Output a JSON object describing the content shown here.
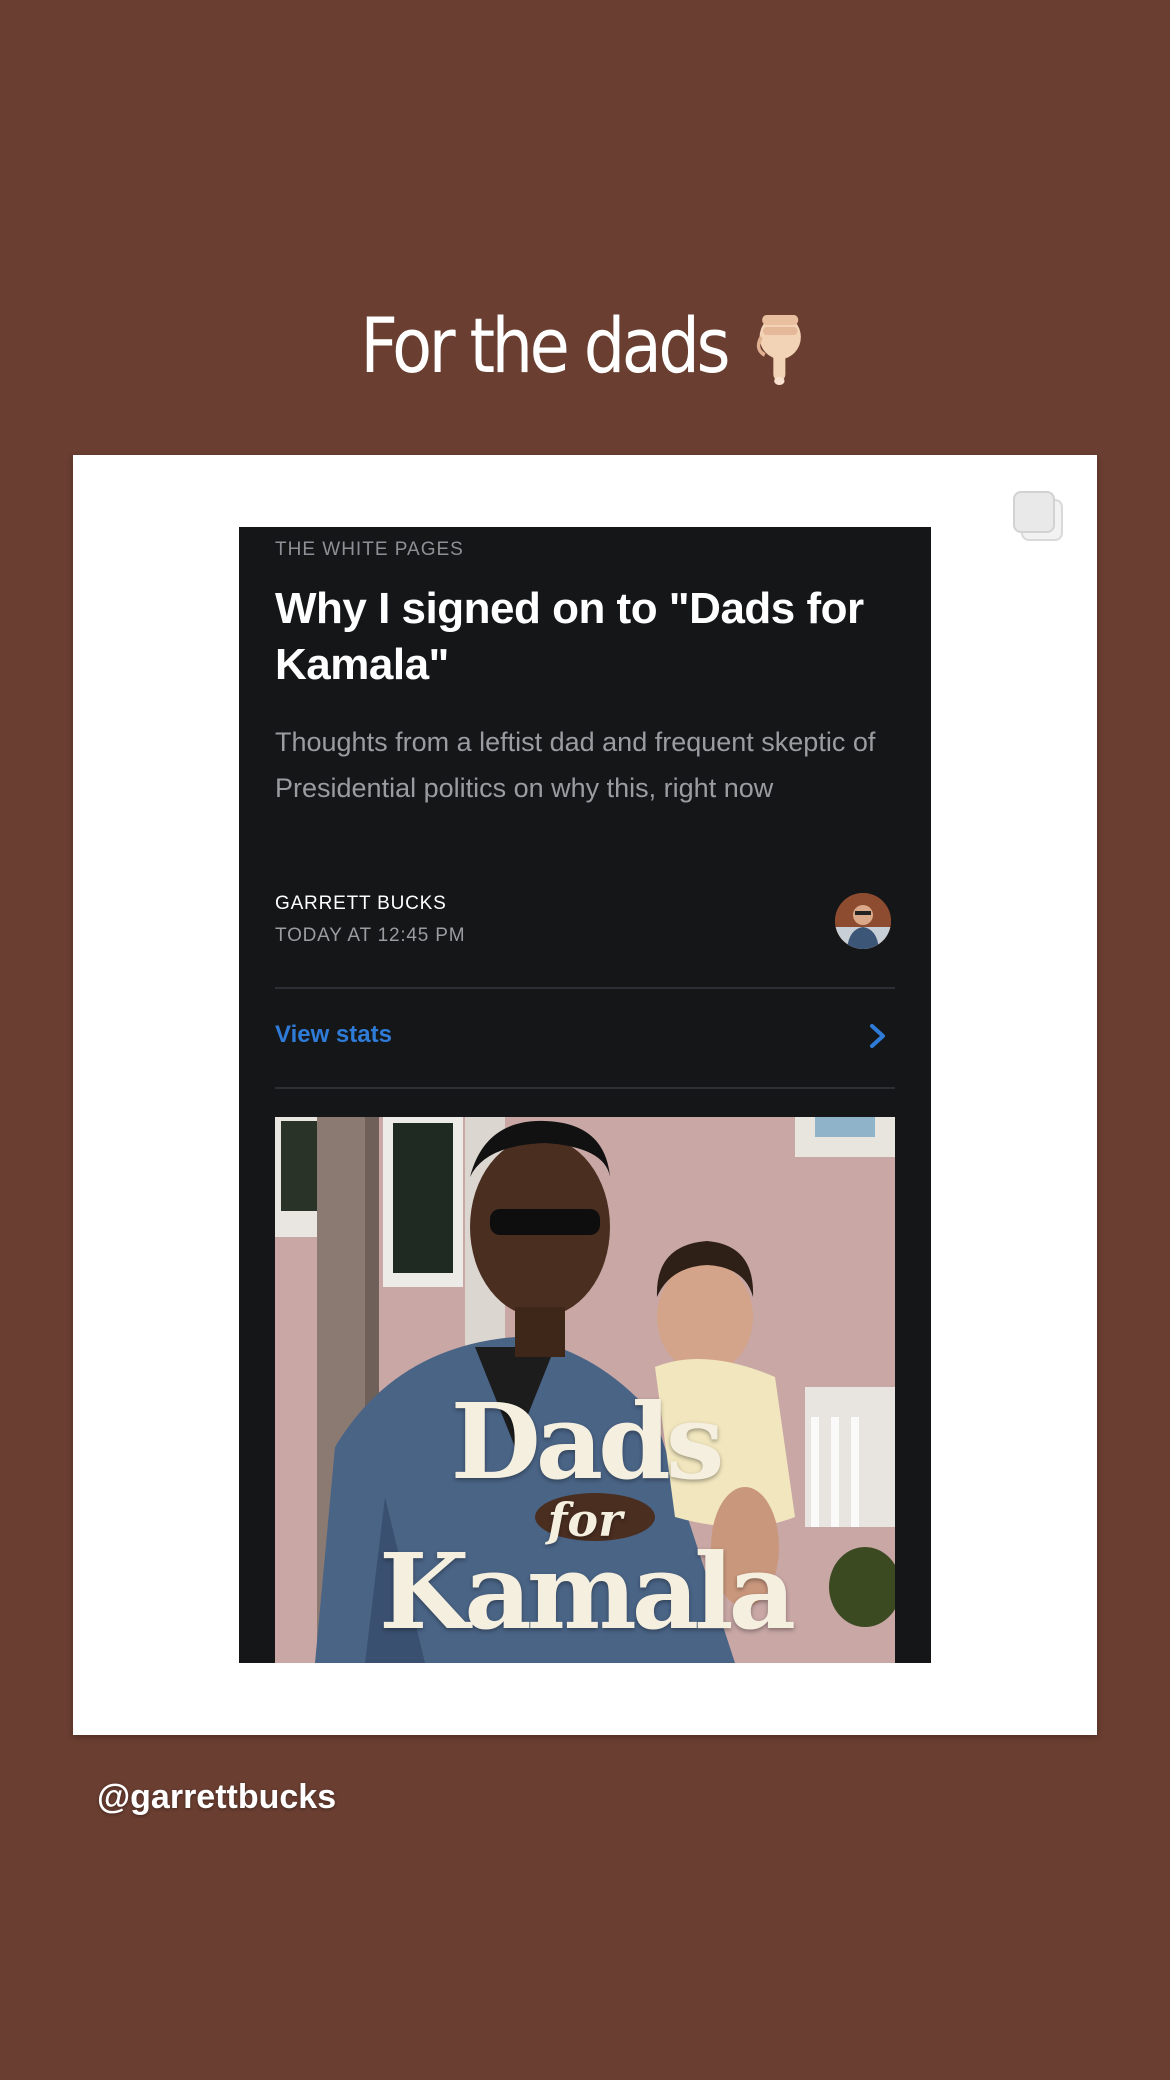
{
  "story": {
    "caption": "For the dads",
    "caption_emoji": "backhand-index-pointing-down-emoji",
    "mention": "@garrettbucks",
    "background_color": "#6a3e31"
  },
  "post": {
    "publication": "THE WHITE PAGES",
    "title": "Why I signed on to \"Dads for Kamala\"",
    "subtitle": "Thoughts from a leftist dad and frequent skeptic of Presidential politics on why this, right now",
    "author": "GARRETT BUCKS",
    "timestamp": "TODAY AT 12:45 PM",
    "view_stats_label": "View stats",
    "link_color": "#2f7bd8",
    "hero": {
      "line1": "Dads",
      "line2": "for",
      "line3": "Kamala"
    }
  },
  "icons": {
    "multi_post": "multiple-photos-icon",
    "chevron": "chevron-right-icon",
    "avatar": "author-avatar"
  }
}
